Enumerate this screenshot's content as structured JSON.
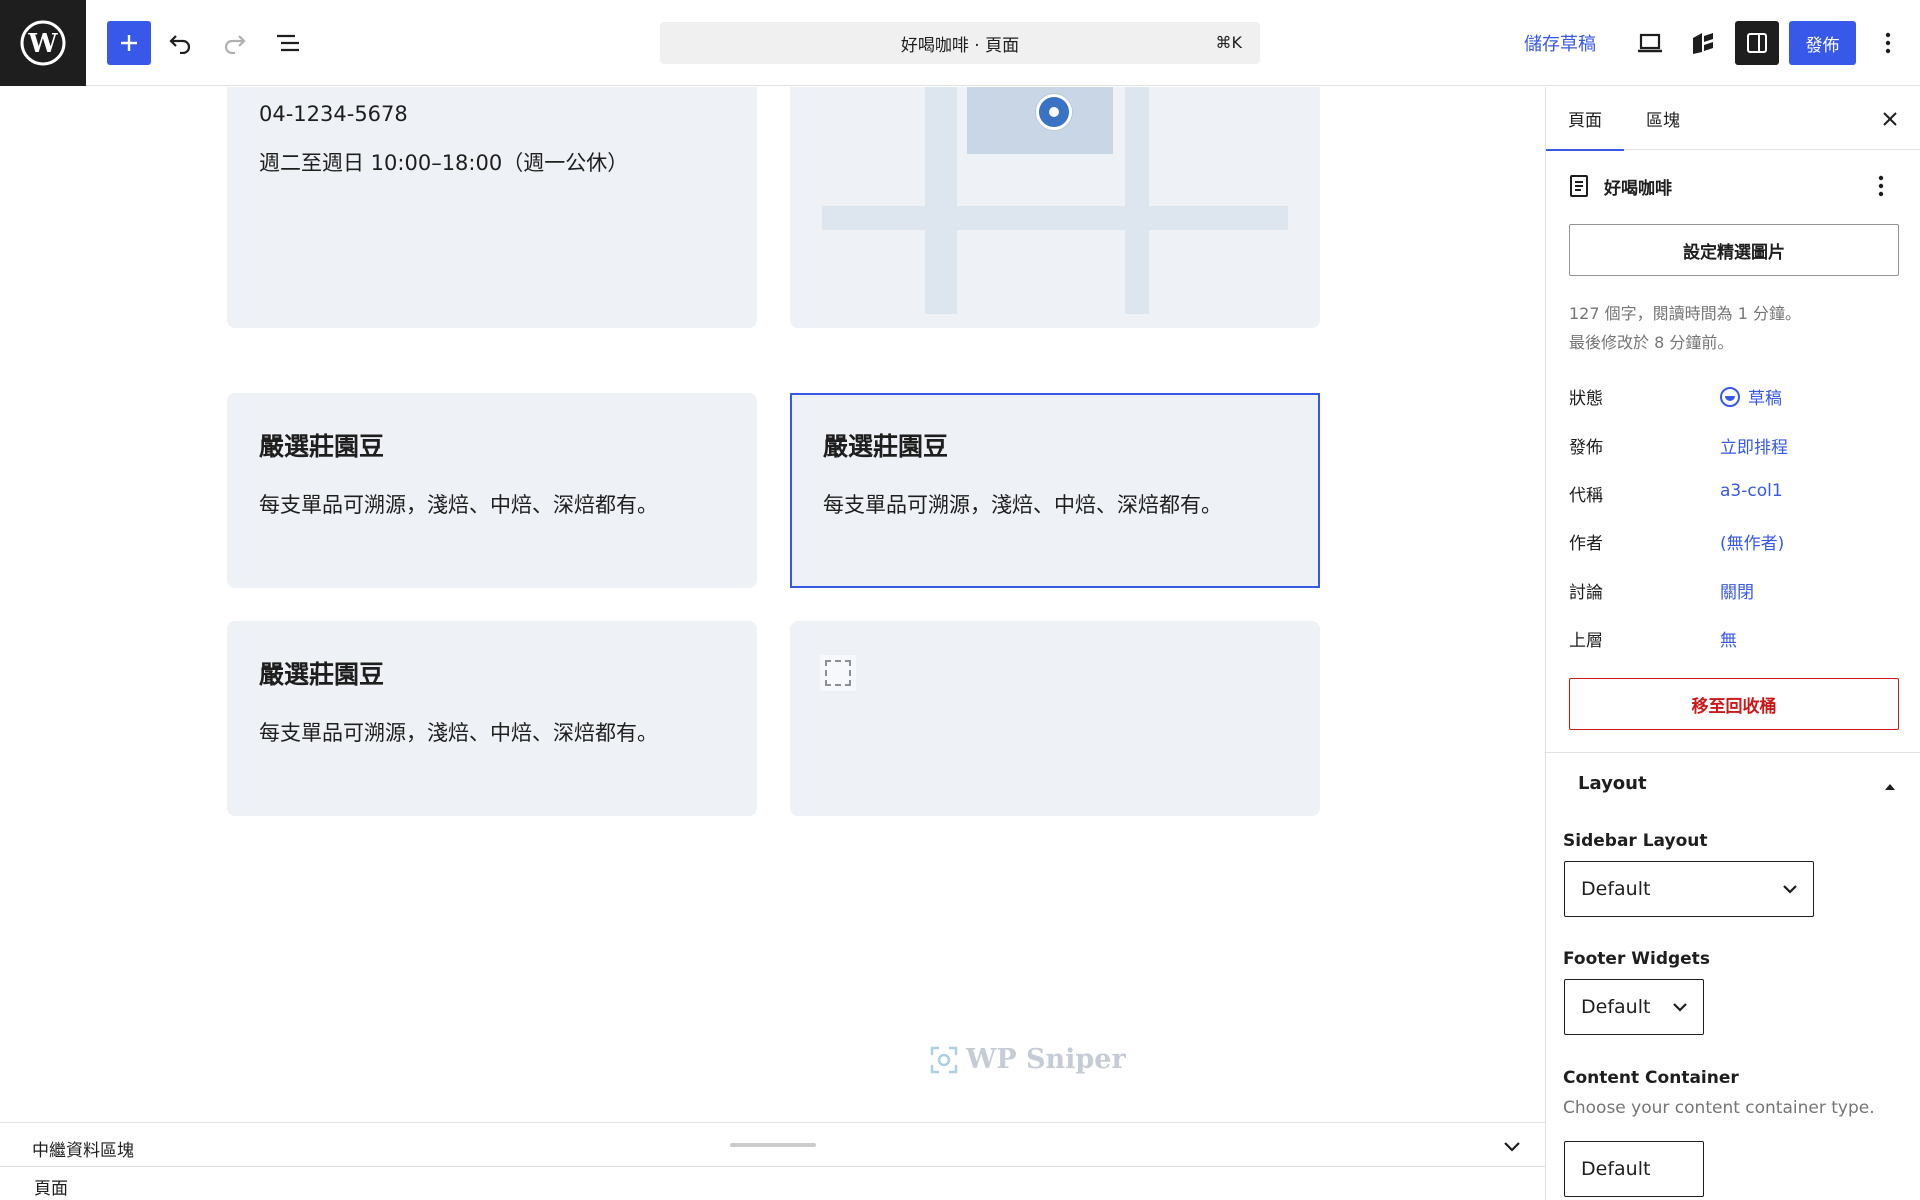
{
  "toolbar": {
    "document_title": "好喝咖啡 · 頁面",
    "shortcut": "⌘K",
    "save_draft": "儲存草稿",
    "publish": "發佈"
  },
  "canvas": {
    "contact": {
      "phone": "04-1234-5678",
      "hours": "週二至週日 10:00–18:00（週一公休）"
    },
    "features": [
      {
        "title": "嚴選莊園豆",
        "desc": "每支單品可溯源，淺焙、中焙、深焙都有。"
      },
      {
        "title": "嚴選莊園豆",
        "desc": "每支單品可溯源，淺焙、中焙、深焙都有。"
      },
      {
        "title": "嚴選莊園豆",
        "desc": "每支單品可溯源，淺焙、中焙、深焙都有。"
      }
    ],
    "watermark": "WP Sniper"
  },
  "bottom_panel": {
    "title": "中繼資料區塊",
    "breadcrumb": "頁面"
  },
  "sidebar": {
    "tabs": [
      "頁面",
      "區塊"
    ],
    "doc_title": "好喝咖啡",
    "featured_image": "設定精選圖片",
    "meta": [
      "127 個字，閱讀時間為 1 分鐘。",
      "最後修改於 8 分鐘前。"
    ],
    "props": [
      {
        "label": "狀態",
        "value": "草稿"
      },
      {
        "label": "發佈",
        "value": "立即排程"
      },
      {
        "label": "代稱",
        "value": "a3-col1"
      },
      {
        "label": "作者",
        "value": "(無作者)"
      },
      {
        "label": "討論",
        "value": "關閉"
      },
      {
        "label": "上層",
        "value": "無"
      }
    ],
    "trash": "移至回收桶",
    "layout": {
      "heading": "Layout",
      "sidebar_layout_label": "Sidebar Layout",
      "sidebar_layout_value": "Default",
      "footer_widgets_label": "Footer Widgets",
      "footer_widgets_value": "Default",
      "content_container_label": "Content Container",
      "content_container_help": "Choose your content container type.",
      "content_container_value": "Default"
    }
  },
  "colors": {
    "accent": "#3858e9",
    "danger": "#cc1818",
    "card_bg": "#eef1f5"
  }
}
